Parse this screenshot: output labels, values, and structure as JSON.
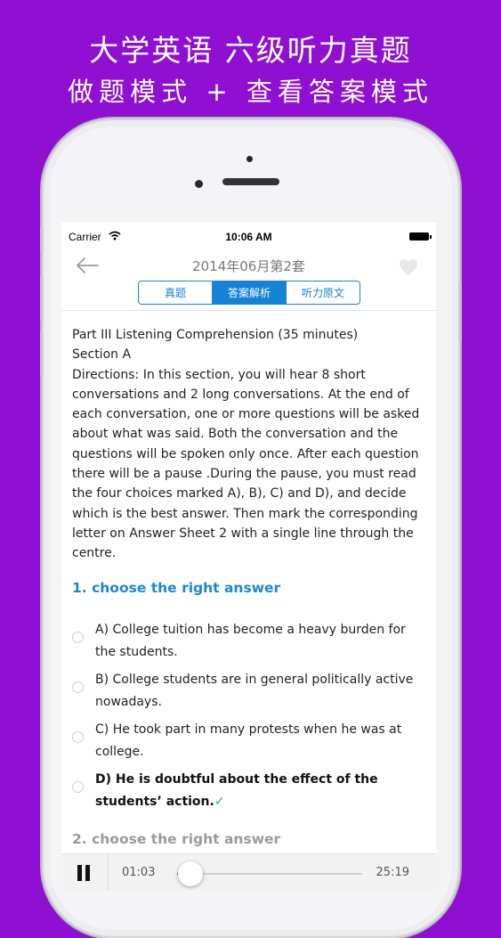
{
  "promo": {
    "line1": "大学英语  六级听力真题",
    "line2": "做题模式 + 查看答案模式"
  },
  "status_bar": {
    "carrier": "Carrier",
    "time": "10:06 AM",
    "wifi_icon": "wifi-icon",
    "battery_icon": "battery-icon"
  },
  "nav": {
    "title": "2014年06月第2套",
    "back_icon": "arrow-left-icon",
    "favorite_icon": "heart-icon",
    "tabs": [
      {
        "label": "真题",
        "active": false
      },
      {
        "label": "答案解析",
        "active": true
      },
      {
        "label": "听力原文",
        "active": false
      }
    ]
  },
  "content": {
    "heading": "Part III Listening Comprehension (35 minutes)",
    "section": "Section A",
    "directions": "Directions: In this section, you will hear 8 short conversations and 2 long conversations. At the end of each conversation, one or more questions will be asked about what was said. Both the conversation and the questions will be spoken only once. After each question there will be a pause .During the pause, you must read the four choices marked A), B), C) and D), and decide which is the best answer. Then mark the corresponding letter on Answer Sheet 2 with a single line through the centre."
  },
  "question1": {
    "title": "1. choose the right answer",
    "options": [
      {
        "text": "A) College tuition has become a heavy burden for the students.",
        "correct": false
      },
      {
        "text": "B) College students are in general politically active nowadays.",
        "correct": false
      },
      {
        "text": "C) He took part in many protests when he was at college.",
        "correct": false
      },
      {
        "text": "D) He is doubtful about the effect of the students’ action.",
        "correct": true
      }
    ],
    "correct_mark": "✓"
  },
  "question2": {
    "title": "2. choose the right answer"
  },
  "player": {
    "current_time": "01:03",
    "total_time": "25:19",
    "progress": 0.07,
    "pause_icon": "pause-icon"
  },
  "colors": {
    "background": "#8f0fd3",
    "accent": "#1583d8",
    "correct": "#23b07f"
  }
}
